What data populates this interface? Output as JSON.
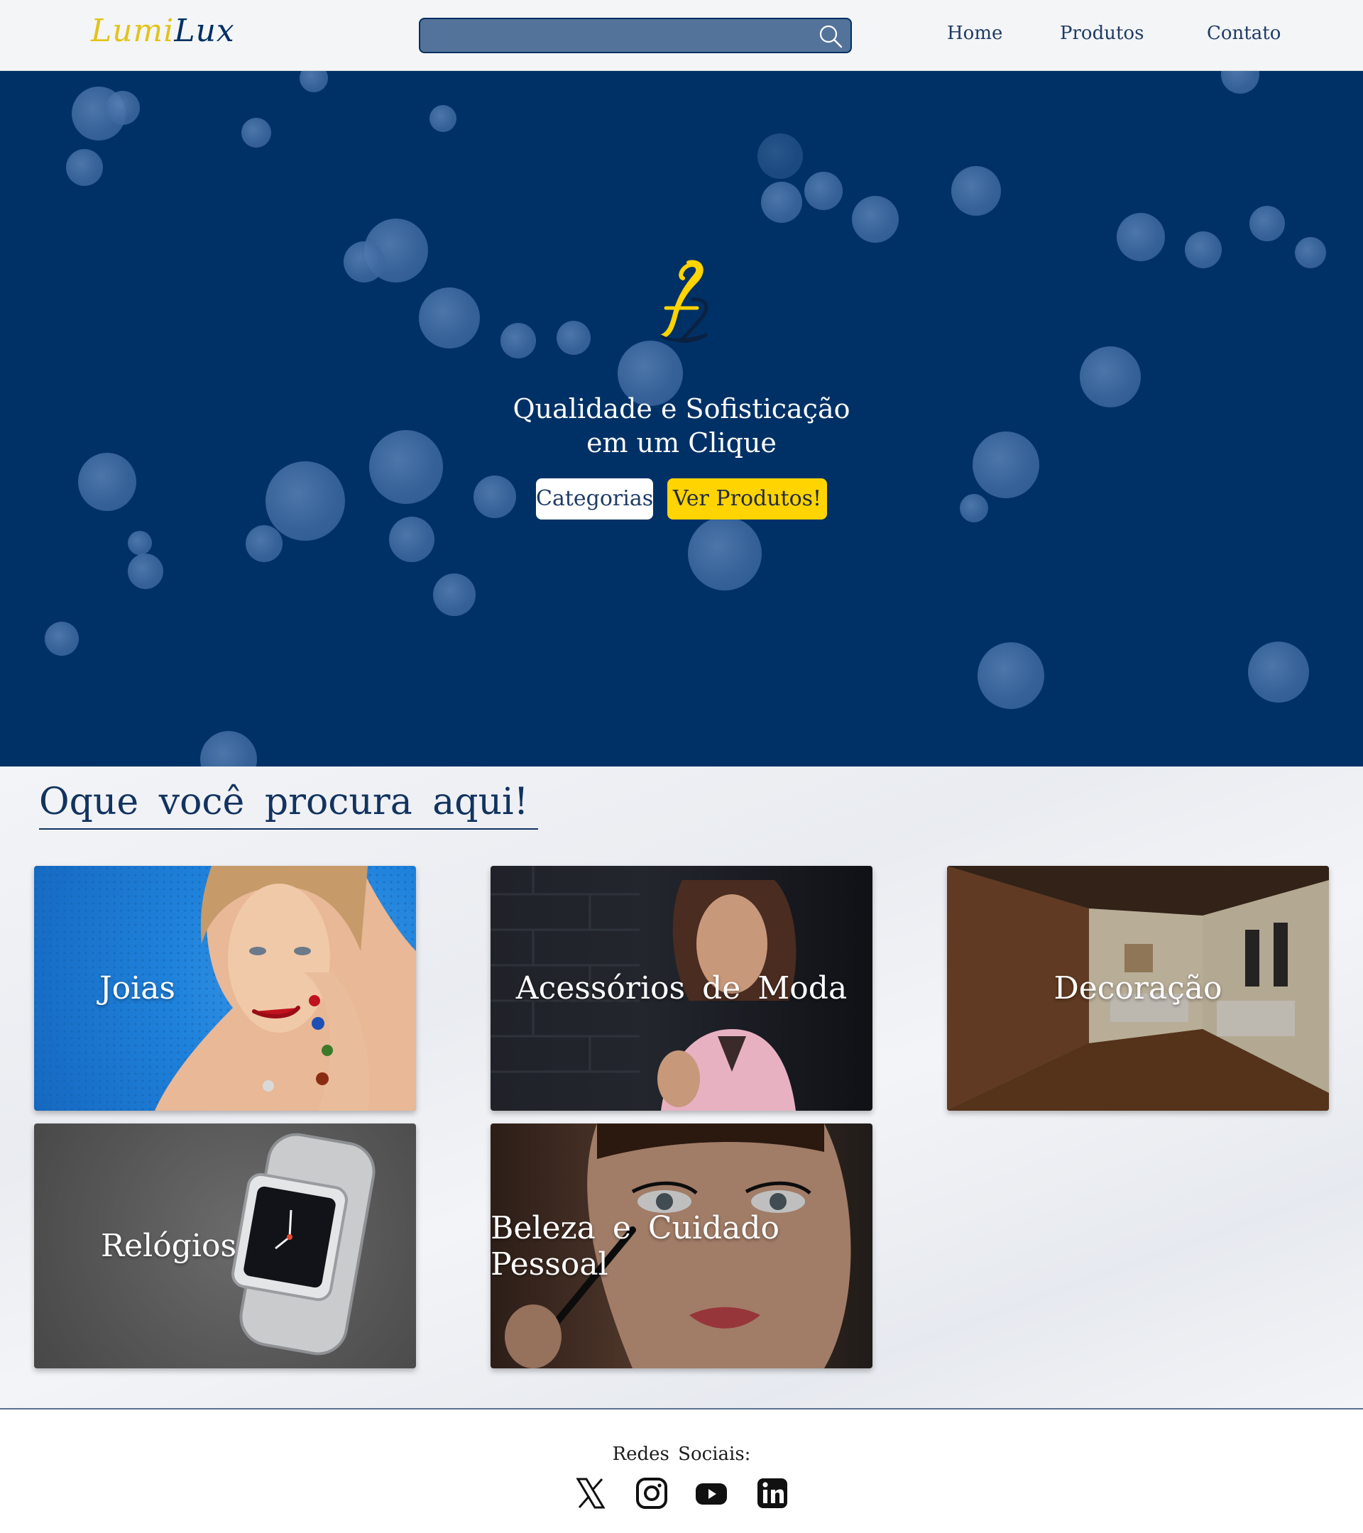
{
  "header": {
    "logo_part1": "Lumi",
    "logo_part2": "Lux",
    "search_placeholder": "",
    "nav": [
      "Home",
      "Produtos",
      "Contato"
    ]
  },
  "hero": {
    "tagline_line1": "Qualidade e Sofisticação",
    "tagline_line2": "em um Clique",
    "buttons": {
      "categorias": "Categorias",
      "ver_produtos": "Ver Produtos!"
    }
  },
  "section": {
    "title": "Oque você procura aqui!",
    "categories": [
      "Joias",
      "Acessórios de Moda",
      "Decoração",
      "Relógios",
      "Beleza e Cuidado Pessoal"
    ]
  },
  "footer": {
    "title": "Redes Sociais:",
    "social": [
      "x-icon",
      "instagram-icon",
      "youtube-icon",
      "linkedin-icon"
    ]
  },
  "colors": {
    "brand_navy": "#003166",
    "brand_gold": "#ffd400",
    "search_blue": "#54739a",
    "title_navy": "#12335f"
  }
}
